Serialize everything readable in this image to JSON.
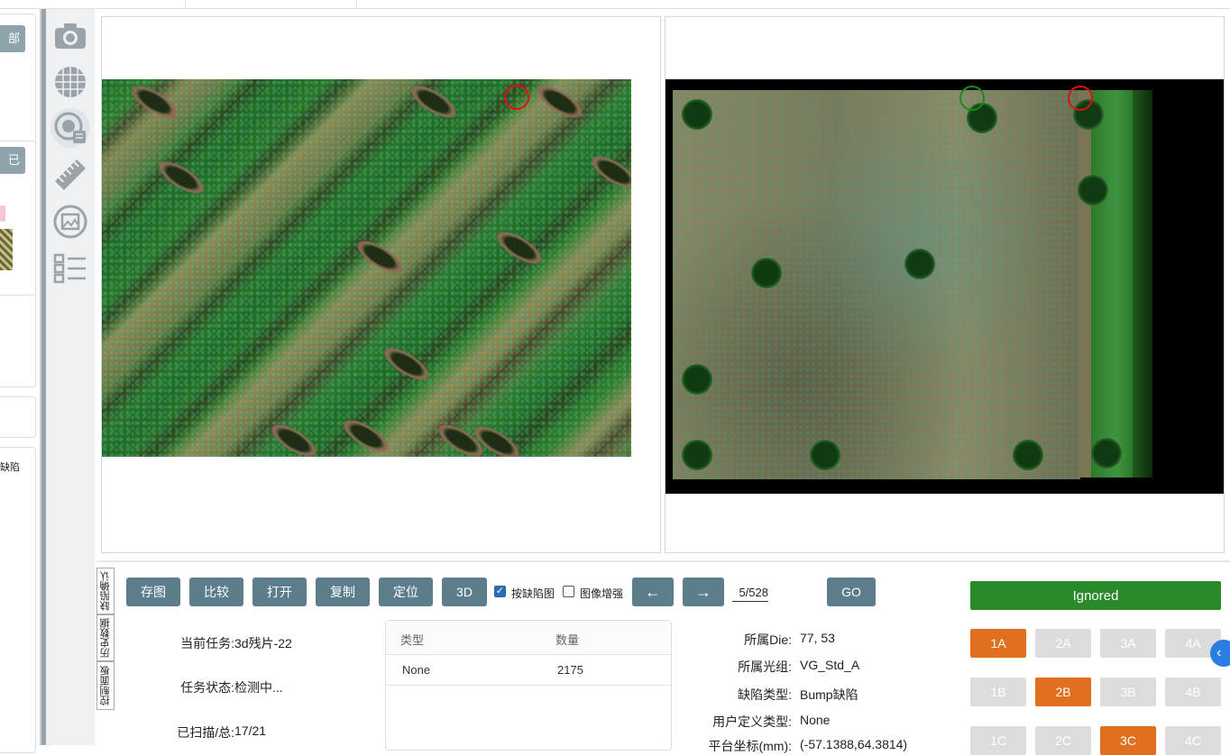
{
  "left_panel": {
    "btn_top": "部",
    "btn_mid": "已",
    "text_bottom": "缺陷"
  },
  "icons": [
    "camera-icon",
    "wafer-icon",
    "wafer-map-icon",
    "ruler-icon",
    "image-icon",
    "checklist-icon"
  ],
  "side_tabs": [
    "缺陷确认",
    "历史数据",
    "控制面板"
  ],
  "toolbar": {
    "save_image": "存图",
    "compare": "比较",
    "open": "打开",
    "copy": "复制",
    "locate": "定位",
    "view_3d": "3D",
    "by_defect_label": "按缺陷图",
    "by_defect_checked": true,
    "enhance_label": "图像增强",
    "enhance_checked": false,
    "prev": "←",
    "next": "→",
    "page": "5/528",
    "go": "GO"
  },
  "task_info": {
    "current_task_label": "当前任务:",
    "current_task_value": "3d残片-22",
    "status_label": "任务状态:",
    "status_value": "检测中...",
    "scanned_label": "已扫描/总:",
    "scanned_value": "17/21"
  },
  "defect_table": {
    "columns": [
      "类型",
      "数量"
    ],
    "rows": [
      [
        "None",
        "2175"
      ]
    ]
  },
  "defect_detail": {
    "die_label": "所属Die:",
    "die_value": "77, 53",
    "recipe_label": "所属光组:",
    "recipe_value": "VG_Std_A",
    "type_label": "缺陷类型:",
    "type_value": "Bump缺陷",
    "user_type_label": "用户定义类型:",
    "user_type_value": "None",
    "coord_label": "平台坐标(mm):",
    "coord_value": "(-57.1388,64.3814)"
  },
  "classify": {
    "ignored": "Ignored",
    "buttons": [
      {
        "label": "1A",
        "active": true
      },
      {
        "label": "2A",
        "active": false
      },
      {
        "label": "3A",
        "active": false
      },
      {
        "label": "4A",
        "active": false
      },
      {
        "label": "1B",
        "active": false
      },
      {
        "label": "2B",
        "active": true
      },
      {
        "label": "3B",
        "active": false
      },
      {
        "label": "4B",
        "active": false
      },
      {
        "label": "1C",
        "active": false
      },
      {
        "label": "2C",
        "active": false
      },
      {
        "label": "3C",
        "active": true
      },
      {
        "label": "4C",
        "active": false
      }
    ],
    "active_color": "#e07020",
    "ignored_color": "#2a8a2a"
  },
  "collapse_icon": "chevron-left-icon"
}
